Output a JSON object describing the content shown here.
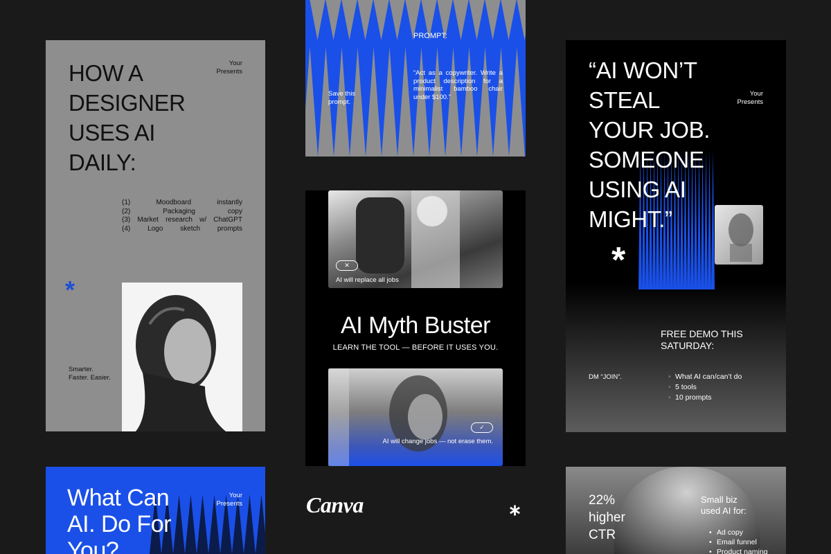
{
  "card_design": {
    "title": "HOW A DESIGNER USES AI DAILY:",
    "brand": "Your Presents",
    "list": [
      {
        "num": "(1)",
        "words": [
          "Moodboard",
          "instantly"
        ]
      },
      {
        "num": "(2)",
        "words": [
          "Packaging",
          "copy"
        ]
      },
      {
        "num": "(3)",
        "words": [
          "Market",
          "research",
          "w/",
          "ChatGPT"
        ]
      },
      {
        "num": "(4)",
        "words": [
          "Logo",
          "sketch",
          "prompts"
        ]
      }
    ],
    "tagline_1": "Smarter.",
    "tagline_2": "Faster. Easier."
  },
  "card_prompt": {
    "label": "PROMPT:",
    "body": "“Act as a copywriter. Write a product description for a minimalist bamboo chair under $100.”",
    "save_1": "Save this",
    "save_2": "prompt."
  },
  "card_myth": {
    "caption_top": "AI will replace all jobs",
    "title": "AI Myth Buster",
    "subtitle": "LEARN THE TOOL — BEFORE IT USES YOU.",
    "caption_bottom": "AI will change jobs — not erase them."
  },
  "card_quote": {
    "quote_lines": [
      "“AI WON’T",
      "STEAL",
      "YOUR JOB.",
      "SOMEONE",
      "USING AI",
      "MIGHT.”"
    ],
    "brand": "Your Presents",
    "demo_1": "FREE DEMO THIS",
    "demo_2": "SATURDAY:",
    "dm": "DM “JOIN”.",
    "bullets": [
      "What AI can/can’t do",
      "5 tools",
      "10 prompts"
    ]
  },
  "card_blue": {
    "title_1": "What Can",
    "title_2": "AI. Do For",
    "title_3": "You?",
    "brand": "Your Presents"
  },
  "card_ctr": {
    "stat_1": "22%",
    "stat_2": "higher",
    "stat_3": "CTR",
    "used_1": "Small biz",
    "used_2": "used AI for:",
    "bullets": [
      "Ad copy",
      "Email funnel",
      "Product naming"
    ]
  },
  "brand_logo": "Canva",
  "colors": {
    "accent": "#1a50e8",
    "grey": "#8e8e8e",
    "dark": "#1a1a1a"
  }
}
